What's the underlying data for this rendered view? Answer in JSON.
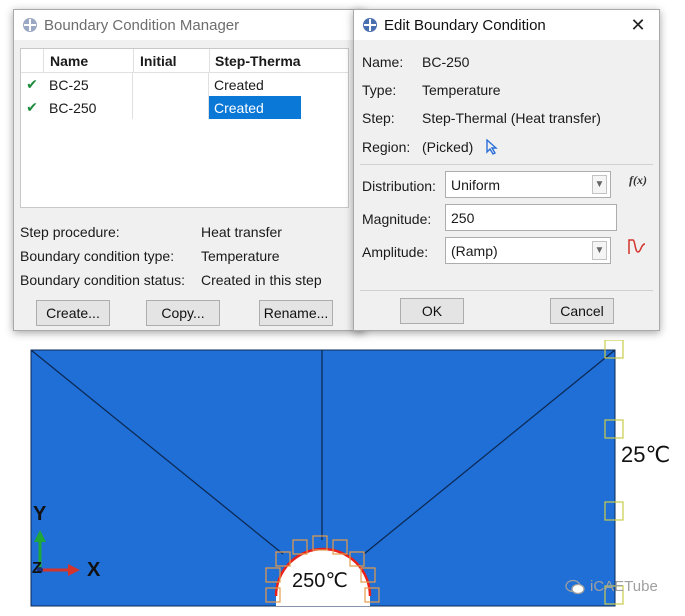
{
  "manager": {
    "title": "Boundary Condition Manager",
    "columns": [
      "Name",
      "Initial",
      "Step-Therma"
    ],
    "rows": [
      {
        "check": "✔",
        "name": "BC-25",
        "initial": "",
        "step": "Created"
      },
      {
        "check": "✔",
        "name": "BC-250",
        "initial": "",
        "step": "Created"
      }
    ],
    "info": {
      "procedure_label": "Step procedure:",
      "procedure_value": "Heat transfer",
      "type_label": "Boundary condition type:",
      "type_value": "Temperature",
      "status_label": "Boundary condition status:",
      "status_value": "Created in this step"
    },
    "buttons": {
      "create": "Create...",
      "copy": "Copy...",
      "rename": "Rename..."
    }
  },
  "edit": {
    "title": "Edit Boundary Condition",
    "name_label": "Name:",
    "name_value": "BC-250",
    "type_label": "Type:",
    "type_value": "Temperature",
    "step_label": "Step:",
    "step_value": "Step-Thermal (Heat transfer)",
    "region_label": "Region:",
    "region_value": "(Picked)",
    "distribution_label": "Distribution:",
    "distribution_value": "Uniform",
    "fx_label": "f(x)",
    "magnitude_label": "Magnitude:",
    "magnitude_value": "250",
    "amplitude_label": "Amplitude:",
    "amplitude_value": "(Ramp)",
    "ok": "OK",
    "cancel": "Cancel",
    "close": "✕"
  },
  "viewport": {
    "label_outer": "25℃",
    "label_inner": "250℃",
    "axis_y": "Y",
    "axis_x": "X",
    "axis_z": "Z",
    "watermark": "iCAETube",
    "fill_color": "#1f6fd6",
    "bc_color": "#e8201a"
  }
}
